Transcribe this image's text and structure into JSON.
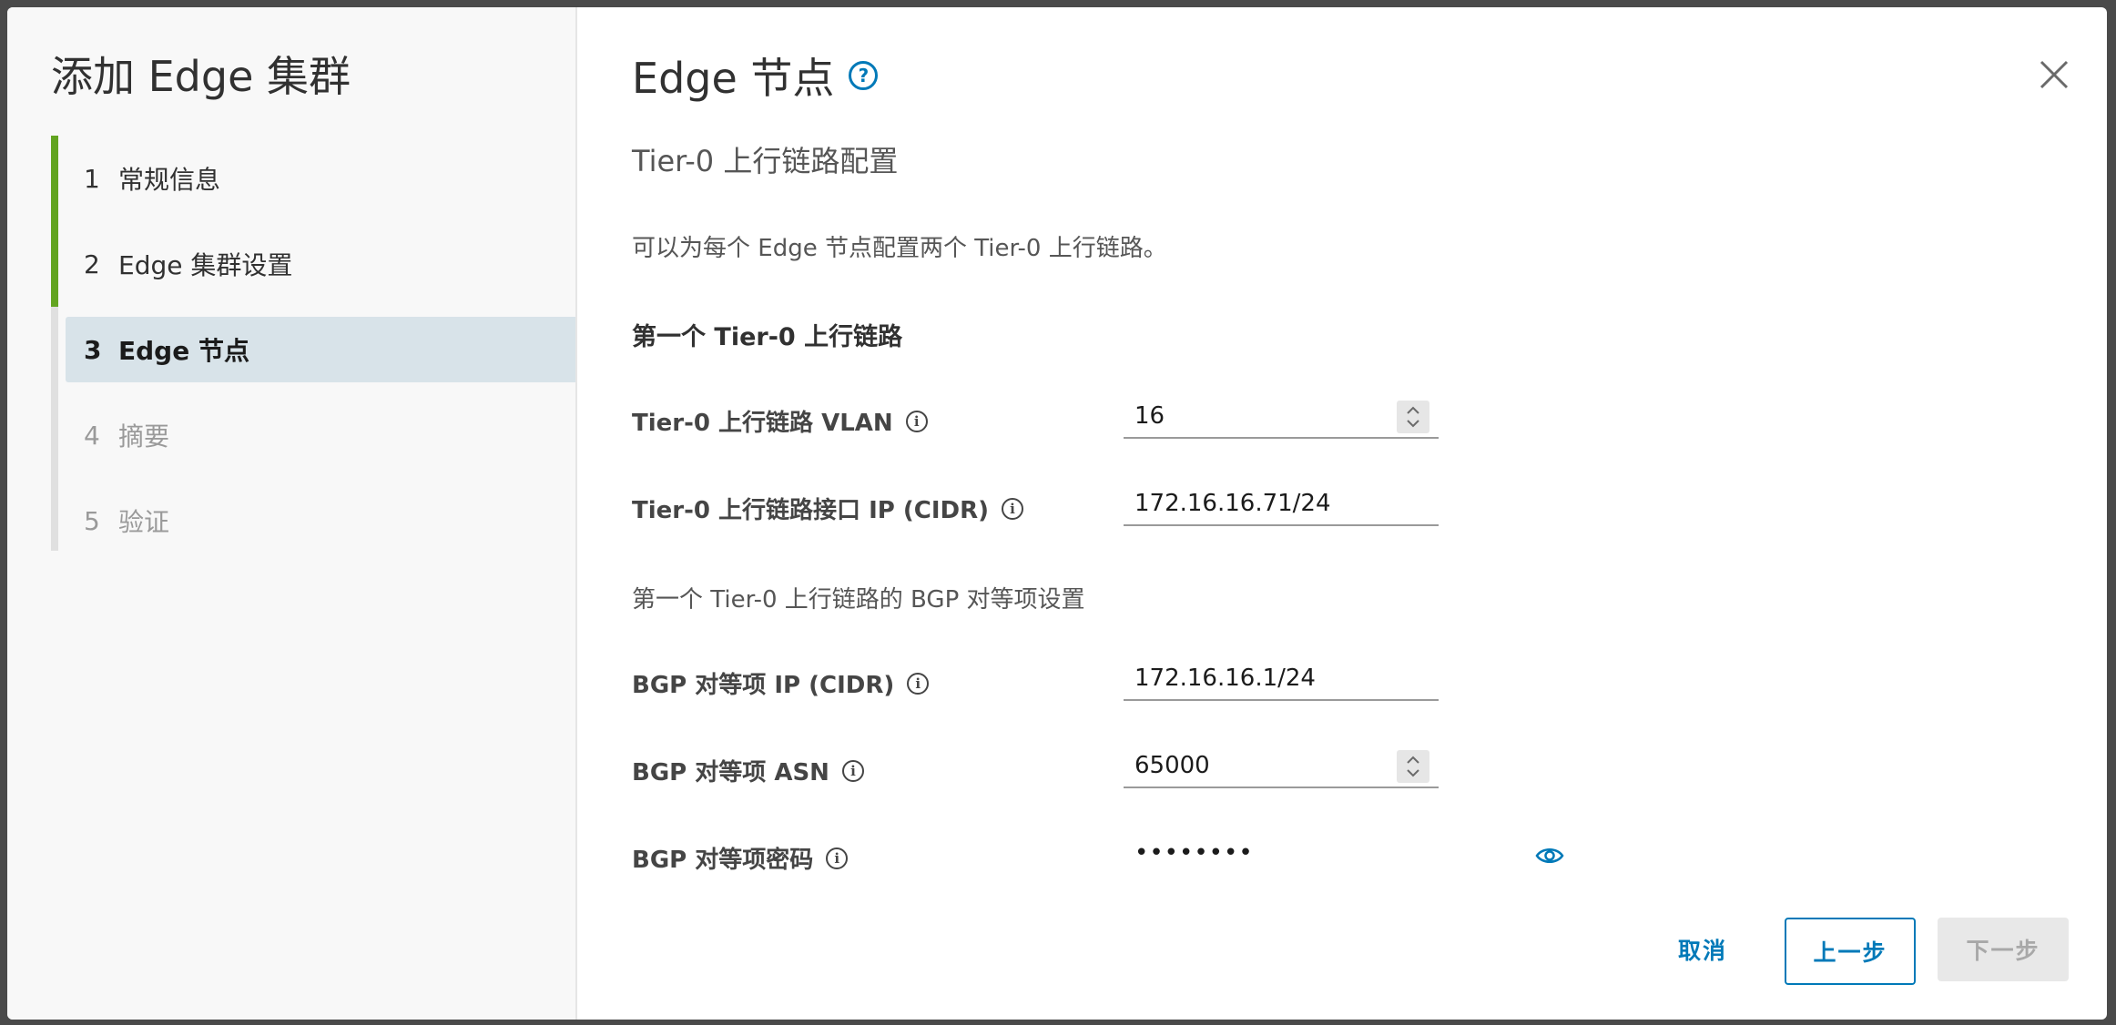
{
  "wizard": {
    "title": "添加 Edge 集群",
    "steps": [
      {
        "num": "1",
        "label": "常规信息",
        "state": "done"
      },
      {
        "num": "2",
        "label": "Edge 集群设置",
        "state": "done"
      },
      {
        "num": "3",
        "label": "Edge 节点",
        "state": "current"
      },
      {
        "num": "4",
        "label": "摘要",
        "state": "pending"
      },
      {
        "num": "5",
        "label": "验证",
        "state": "pending"
      }
    ]
  },
  "page": {
    "title": "Edge 节点",
    "help_icon": "question-circle-icon",
    "close_icon": "close-icon",
    "section_title": "Tier-0 上行链路配置",
    "description": "可以为每个 Edge 节点配置两个 Tier-0 上行链路。",
    "first_uplink_heading": "第一个 Tier-0 上行链路",
    "bgp_heading": "第一个 Tier-0 上行链路的 BGP 对等项设置"
  },
  "fields": {
    "vlan": {
      "label": "Tier-0 上行链路 VLAN",
      "value": "16"
    },
    "interface_ip": {
      "label": "Tier-0 上行链路接口 IP (CIDR)",
      "value": "172.16.16.71/24"
    },
    "bgp_peer_ip": {
      "label": "BGP 对等项 IP (CIDR)",
      "value": "172.16.16.1/24"
    },
    "bgp_peer_asn": {
      "label": "BGP 对等项 ASN",
      "value": "65000"
    },
    "bgp_peer_password": {
      "label": "BGP 对等项密码",
      "value": "••••••••"
    }
  },
  "buttons": {
    "cancel": "取消",
    "previous": "上一步",
    "next": "下一步"
  },
  "colors": {
    "accent": "#0079b8",
    "step_done": "#62a420",
    "step_current_bg": "#d8e3e9"
  }
}
